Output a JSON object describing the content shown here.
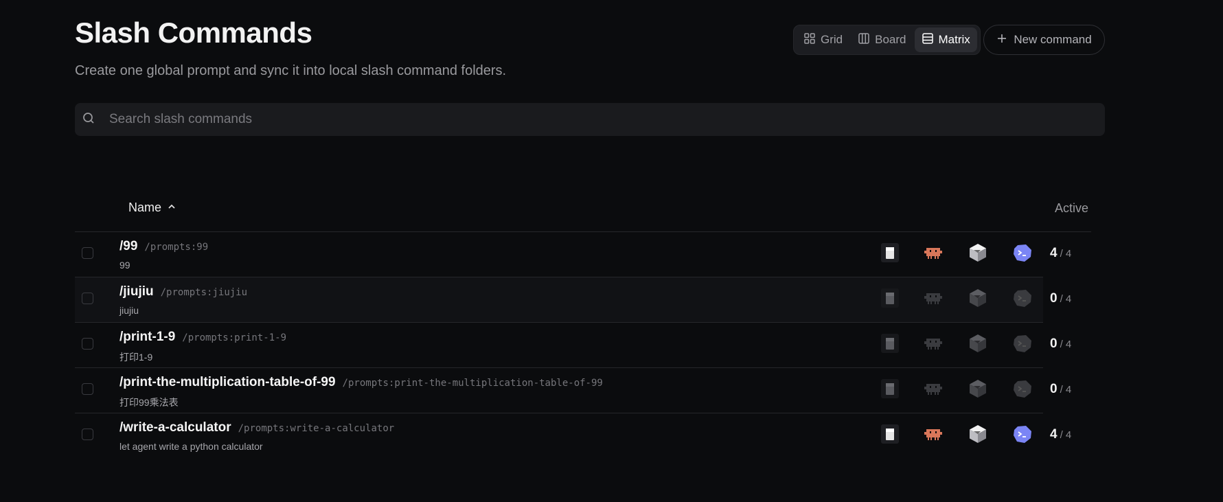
{
  "page": {
    "title": "Slash Commands",
    "subtitle": "Create one global prompt and sync it into local slash command folders."
  },
  "view_switch": {
    "options": [
      {
        "label": "Grid",
        "icon": "grid-icon",
        "active": false
      },
      {
        "label": "Board",
        "icon": "board-columns-icon",
        "active": false
      },
      {
        "label": "Matrix",
        "icon": "matrix-table-icon",
        "active": true
      }
    ]
  },
  "new_command": {
    "label": "New command",
    "icon": "plus-icon"
  },
  "search": {
    "placeholder": "Search slash commands",
    "value": "",
    "icon": "search-icon"
  },
  "table": {
    "name_header": "Name",
    "sort_icon": "chevron-up-icon",
    "active_header": "Active",
    "tools": [
      "cursor-tool",
      "claude-tool",
      "codex-tool",
      "gemini-tool"
    ],
    "rows": [
      {
        "name": "/99",
        "path": "/prompts:99",
        "desc": "99",
        "enabled": true,
        "active": "4",
        "total": "/ 4"
      },
      {
        "name": "/jiujiu",
        "path": "/prompts:jiujiu",
        "desc": "jiujiu",
        "enabled": false,
        "active": "0",
        "total": "/ 4"
      },
      {
        "name": "/print-1-9",
        "path": "/prompts:print-1-9",
        "desc": "打印1-9",
        "enabled": false,
        "active": "0",
        "total": "/ 4"
      },
      {
        "name": "/print-the-multiplication-table-of-99",
        "path": "/prompts:print-the-multiplication-table-of-99",
        "desc": "打印99乘法表",
        "enabled": false,
        "active": "0",
        "total": "/ 4"
      },
      {
        "name": "/write-a-calculator",
        "path": "/prompts:write-a-calculator",
        "desc": "let agent write a python calculator",
        "enabled": true,
        "active": "4",
        "total": "/ 4"
      }
    ]
  },
  "colors": {
    "background": "#0b0c0e",
    "claude": "#d9775a",
    "gemini": "#7b85f5",
    "disabled": "#3a3b3f"
  }
}
